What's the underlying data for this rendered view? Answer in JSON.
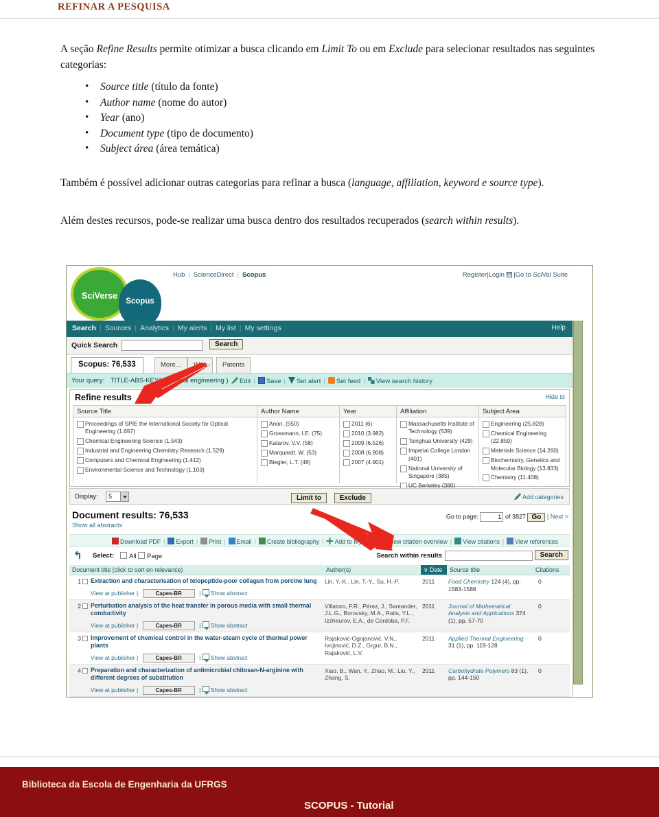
{
  "page": {
    "title": "REFINAR A PESQUISA",
    "paragraph1_a": "A seção ",
    "paragraph1_i1": "Refine Results",
    "paragraph1_b": " permite otimizar a busca clicando em ",
    "paragraph1_i2": "Limit To",
    "paragraph1_c": " ou em ",
    "paragraph1_i3": "Exclude",
    "paragraph1_d": " para selecionar resultados nas seguintes categorias:",
    "bullets": [
      {
        "term": "Source title",
        "gloss": " (título da fonte)"
      },
      {
        "term": "Author name",
        "gloss": " (nome do autor)"
      },
      {
        "term": "Year",
        "gloss": " (ano)"
      },
      {
        "term": "Document type",
        "gloss": " (tipo de documento)"
      },
      {
        "term": "Subject área",
        "gloss": " (área temática)"
      }
    ],
    "paragraph2_a": "Também é possível adicionar outras categorias para refinar a busca (",
    "paragraph2_i": "language, affiliation, keyword e source type",
    "paragraph2_b": ").",
    "paragraph3_a": "Além destes recursos, pode-se realizar uma busca dentro dos resultados recuperados (",
    "paragraph3_i": "search within results",
    "paragraph3_b": ")."
  },
  "colors": {
    "title": "#8f3b17",
    "teal": "#1b6b75",
    "query_bar": "#cdeee6",
    "footer": "#8b0f10",
    "arrow_red": "#e8281e",
    "logo_green": "#3ba935",
    "logo_ring": "#b7d432"
  },
  "scopus": {
    "brand": {
      "sciverse": "SciVerse",
      "scopus": "Scopus"
    },
    "top_links": [
      "Hub",
      "ScienceDirect",
      "Scopus"
    ],
    "top_right": {
      "register": "Register",
      "login": "Login",
      "scival": "Go to SciVal Suite"
    },
    "nav": [
      "Search",
      "Sources",
      "Analytics",
      "My alerts",
      "My list",
      "My settings"
    ],
    "nav_help": "Help",
    "quick_search": {
      "label": "Quick Search",
      "value": "",
      "placeholder": "",
      "button": "Search"
    },
    "tabs": [
      {
        "label": "Scopus: 76,533",
        "active": true
      },
      {
        "label": "More...",
        "active": false
      },
      {
        "label": "Web",
        "active": false
      },
      {
        "label": "Patents",
        "active": false
      }
    ],
    "query": {
      "label": "Your query:",
      "text": "TITLE-ABS-KEY( chemical  engineering )",
      "actions": [
        "Edit",
        "Save",
        "Set alert",
        "Set feed",
        "View search history"
      ]
    },
    "refine": {
      "title": "Refine results",
      "hide": "Hide",
      "columns": [
        {
          "header": "Source Title",
          "items": [
            "Proceedings of SPIE the International Society for Optical Engineering (1.657)",
            "Chemical Engineering Science (1.543)",
            "Industrial and Engineering Chemistry Research (1.529)",
            "Computers and Chemical Engineering (1.412)",
            "Environmental Science and Technology (1.103)"
          ]
        },
        {
          "header": "Author Name",
          "items": [
            "Anon,  (550)",
            "Grossmann, I.E. (75)",
            "Katarov, V.V. (58)",
            "Marquardt, W. (53)",
            "Biegler, L.T. (48)"
          ]
        },
        {
          "header": "Year",
          "items": [
            "2011 (6)",
            "2010 (3.982)",
            "2009 (6.526)",
            "2008 (6.908)",
            "2007 (4.901)"
          ]
        },
        {
          "header": "Affiliation",
          "items": [
            "Massachusetts Institute of Technology (539)",
            "Tsinghua University (429)",
            "Imperial College London (401)",
            "National University of Singapore (385)",
            "UC Berkeley (380)"
          ]
        },
        {
          "header": "Subject Area",
          "items": [
            "Engineering (25.828)",
            "Chemical Engineering (22.859)",
            "Materials Science (14.260)",
            "Biochemistry, Genetics and Molecular Biology (13.833)",
            "Chemistry (11.408)"
          ]
        }
      ],
      "display_label": "Display:",
      "display_value": "5",
      "limit_to": "Limit to",
      "exclude": "Exclude",
      "add_categories": "Add categories"
    },
    "results": {
      "heading": "Document results: 76,533",
      "show_all": "Show all abstracts",
      "goto_label": "Go to page:",
      "goto_value": "1",
      "goto_of": "of 3827",
      "goto_button": "Go",
      "next": "| Next >",
      "toolbar": [
        "Download PDF",
        "Export",
        "Print",
        "Email",
        "Create bibliography",
        "Add to My List",
        "View citation overview",
        "View citations",
        "View references"
      ],
      "select_label": "Select:",
      "select_all": "All",
      "select_page": "Page",
      "search_within_label": "Search within results",
      "search_within_value": "",
      "search_within_button": "Search",
      "columns": [
        "Document title (click to sort on relevance)",
        "Author(s)",
        "Date",
        "Source title",
        "Citations"
      ],
      "date_sort_marker": "∨",
      "row_links": {
        "publisher": "View at publisher",
        "capes": "Capes-BR",
        "abstract": "Show abstract"
      },
      "rows": [
        {
          "num": "1",
          "title": "Extraction and characterisation of telopeptide-poor collagen from porcine lung",
          "authors": "Lin, Y.-K., Lin, T.-Y., Su, H.-P.",
          "year": "2011",
          "source_italic": "Food Chemistry",
          "source_rest": " 124 (4), pp. 1583-1588",
          "citations": "0"
        },
        {
          "num": "2",
          "title": "Perturbation analysis of the heat transfer in porous media with small thermal conductivity",
          "authors": "Villatoro, F.R., Pérez, J., Santander, J.L.G., Borovsky, M.A., Ratis, Y.L., Izzheurov, E.A., de Córdoba, P.F.",
          "year": "2011",
          "source_italic": "Journal of Mathematical Analysis and Applications",
          "source_rest": " 374 (1), pp. 57-70",
          "citations": "0"
        },
        {
          "num": "3",
          "title": "Improvement of chemical control in the water-steam cycle of thermal power plants",
          "authors": "Rajaković-Ognjanović, V.N., Ivojinović, D.Z., Grgur, B.N., Rajaković, L.V.",
          "year": "2011",
          "source_italic": "Applied Thermal Engineering",
          "source_rest": " 31 (1), pp. 119-128",
          "citations": "0"
        },
        {
          "num": "4",
          "title": "Preparation and characterization of antimicrobial chitosan-N-arginine with different degrees of substitution",
          "authors": "Xiao, B., Wan, Y., Zhao, M., Liu, Y., Zhang, S.",
          "year": "2011",
          "source_italic": "Carbohydrate Polymers",
          "source_rest": " 83 (1), pp. 144-150",
          "citations": "0"
        }
      ]
    }
  },
  "footer": {
    "library": "Biblioteca da Escola de Engenharia da UFRGS",
    "tutorial": "SCOPUS - Tutorial"
  }
}
